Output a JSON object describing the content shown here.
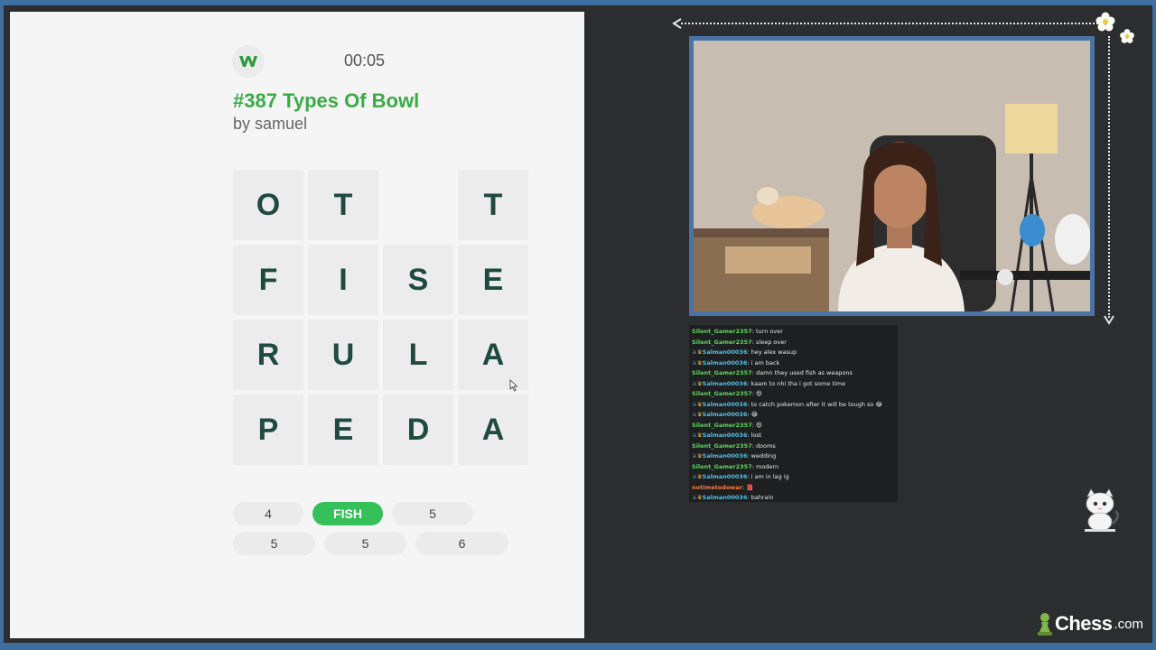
{
  "game": {
    "timer": "00:05",
    "title": "#387 Types Of Bowl",
    "author": "by samuel",
    "grid": [
      [
        "O",
        "T",
        "",
        "T"
      ],
      [
        "F",
        "I",
        "S",
        "E"
      ],
      [
        "R",
        "U",
        "L",
        "A"
      ],
      [
        "P",
        "E",
        "D",
        "A"
      ]
    ],
    "word_slots": {
      "row1": [
        {
          "label": "4",
          "found": false
        },
        {
          "label": "FISH",
          "found": true
        },
        {
          "label": "5",
          "found": false
        }
      ],
      "row2": [
        {
          "label": "5",
          "found": false
        },
        {
          "label": "5",
          "found": false
        },
        {
          "label": "6",
          "found": false
        }
      ]
    },
    "logo_letter": "w"
  },
  "chat": {
    "messages": [
      {
        "user": "Silent_Gamer2357",
        "text": "turn over",
        "color": "green",
        "badges": false
      },
      {
        "user": "Silent_Gamer2357",
        "text": "sleep over",
        "color": "green",
        "badges": false
      },
      {
        "user": "Salman00036",
        "text": "hey alex wasup",
        "color": "blue",
        "badges": true
      },
      {
        "user": "Salman00036",
        "text": "i am back",
        "color": "blue",
        "badges": true
      },
      {
        "user": "Silent_Gamer2357",
        "text": "damn they used fish as weapons",
        "color": "green",
        "badges": false
      },
      {
        "user": "Salman00036",
        "text": "kaam to nhi tha i got some time",
        "color": "blue",
        "badges": true
      },
      {
        "user": "Silent_Gamer2357",
        "text": "😄",
        "color": "green",
        "badges": false
      },
      {
        "user": "Salman00036",
        "text": "to catch pokemon after it will be tough so 😂",
        "color": "blue",
        "badges": true
      },
      {
        "user": "Salman00036",
        "text": "😂",
        "color": "blue",
        "badges": true
      },
      {
        "user": "Silent_Gamer2357",
        "text": "😄",
        "color": "green",
        "badges": false
      },
      {
        "user": "Salman00036",
        "text": "lost",
        "color": "blue",
        "badges": true
      },
      {
        "user": "Silent_Gamer2357",
        "text": "dooms",
        "color": "green",
        "badges": false
      },
      {
        "user": "Salman00036",
        "text": "wedding",
        "color": "blue",
        "badges": true
      },
      {
        "user": "Silent_Gamer2357",
        "text": "modern",
        "color": "green",
        "badges": false
      },
      {
        "user": "Salman00036",
        "text": "i am in lag ig",
        "color": "blue",
        "badges": true
      },
      {
        "user": "notimetodowar",
        "text": "📕",
        "color": "orange",
        "badges": false
      },
      {
        "user": "Salman00036",
        "text": "bahrain",
        "color": "blue",
        "badges": true
      }
    ]
  },
  "branding": {
    "chess_name": "Chess",
    "chess_suffix": ".com"
  },
  "colors": {
    "frame": "#3f6fa0",
    "found_pill": "#36c05a",
    "title_green": "#3aab45",
    "tile_letter": "#1f4a3f"
  }
}
